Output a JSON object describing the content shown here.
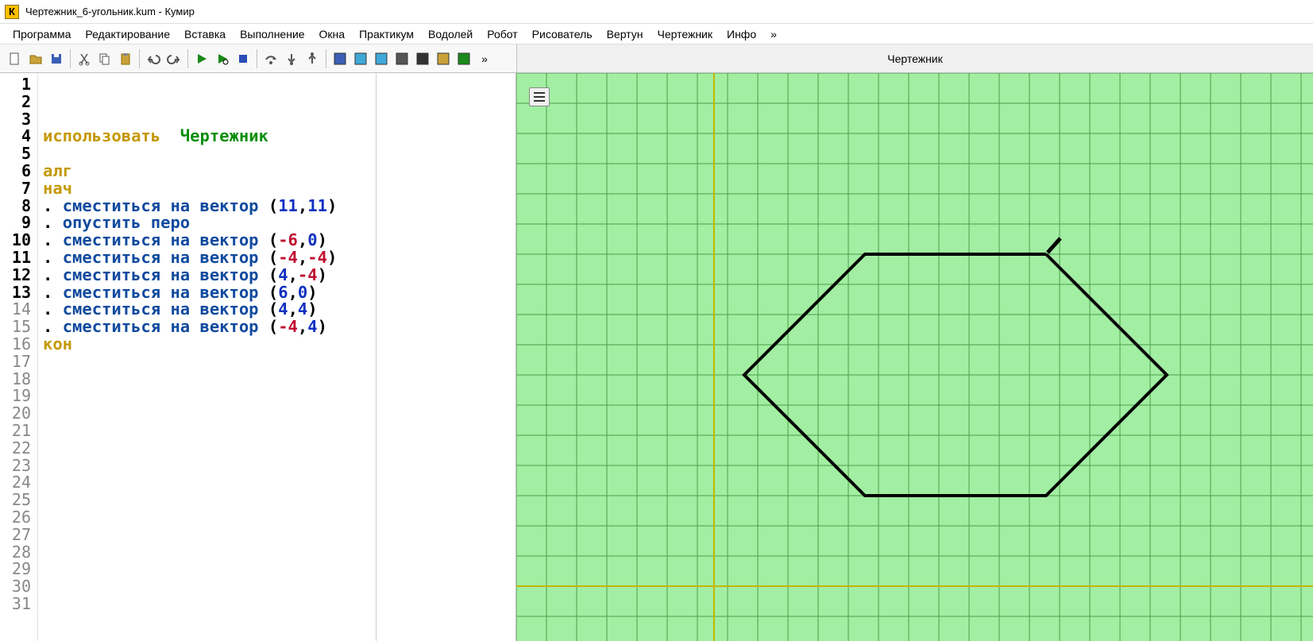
{
  "title": "Чертежник_6-угольник.kum - Кумир",
  "app_icon_letter": "К",
  "menus": [
    "Программа",
    "Редактирование",
    "Вставка",
    "Выполнение",
    "Окна",
    "Практикум",
    "Водолей",
    "Робот",
    "Рисователь",
    "Вертун",
    "Чертежник",
    "Инфо",
    "»"
  ],
  "toolbar_icons": [
    "new",
    "open",
    "save",
    "cut",
    "copy",
    "paste",
    "undo",
    "redo",
    "run",
    "run-visible",
    "stop",
    "step-over",
    "step-into",
    "step-out",
    "module-1",
    "module-2",
    "module-3",
    "module-4",
    "module-5",
    "module-6",
    "module-7"
  ],
  "toolbar_overflow": "»",
  "right_panel_title": "Чертежник",
  "max_line_numbers": 31,
  "code_lines": [
    {
      "n": 1,
      "type": "use",
      "kw": "использовать",
      "ident": "Чертежник"
    },
    {
      "n": 2,
      "type": "blank"
    },
    {
      "n": 3,
      "type": "kw",
      "text": "алг"
    },
    {
      "n": 4,
      "type": "kw",
      "text": "нач"
    },
    {
      "n": 5,
      "type": "move",
      "cmd": "сместиться на вектор",
      "args": [
        {
          "v": "11",
          "neg": false
        },
        {
          "v": "11",
          "neg": false
        }
      ]
    },
    {
      "n": 6,
      "type": "pen",
      "cmd": "опустить перо"
    },
    {
      "n": 7,
      "type": "move",
      "cmd": "сместиться на вектор",
      "args": [
        {
          "v": "-6",
          "neg": true
        },
        {
          "v": "0",
          "neg": false
        }
      ]
    },
    {
      "n": 8,
      "type": "move",
      "cmd": "сместиться на вектор",
      "args": [
        {
          "v": "-4",
          "neg": true
        },
        {
          "v": "-4",
          "neg": true
        }
      ]
    },
    {
      "n": 9,
      "type": "move",
      "cmd": "сместиться на вектор",
      "args": [
        {
          "v": "4",
          "neg": false
        },
        {
          "v": "-4",
          "neg": true
        }
      ]
    },
    {
      "n": 10,
      "type": "move",
      "cmd": "сместиться на вектор",
      "args": [
        {
          "v": "6",
          "neg": false
        },
        {
          "v": "0",
          "neg": false
        }
      ]
    },
    {
      "n": 11,
      "type": "move",
      "cmd": "сместиться на вектор",
      "args": [
        {
          "v": "4",
          "neg": false
        },
        {
          "v": "4",
          "neg": false
        }
      ]
    },
    {
      "n": 12,
      "type": "move",
      "cmd": "сместиться на вектор",
      "args": [
        {
          "v": "-4",
          "neg": true
        },
        {
          "v": "4",
          "neg": false
        }
      ]
    },
    {
      "n": 13,
      "type": "kw",
      "text": "кон"
    }
  ],
  "active_lines": 13,
  "canvas": {
    "cell": 38,
    "origin": {
      "col": 6.55,
      "row": 17
    },
    "hex_points": [
      [
        11,
        11
      ],
      [
        5,
        11
      ],
      [
        1,
        7
      ],
      [
        5,
        3
      ],
      [
        11,
        3
      ],
      [
        15,
        7
      ],
      [
        11,
        11
      ]
    ],
    "pen_at": [
      11,
      11
    ]
  }
}
